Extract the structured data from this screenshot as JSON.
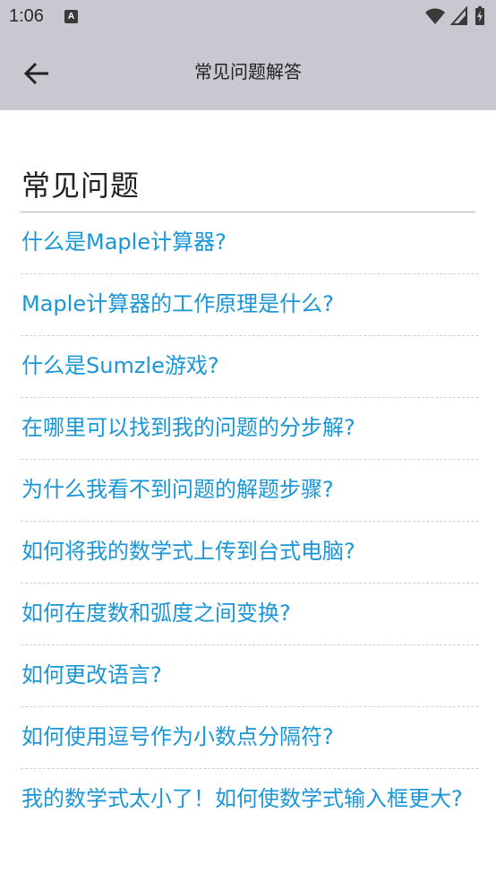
{
  "status_bar": {
    "time": "1:06",
    "notification_icon": "A"
  },
  "app_bar": {
    "title": "常见问题解答",
    "back_icon": "arrow-left-icon"
  },
  "section": {
    "title": "常见问题"
  },
  "faq": [
    "什么是Maple计算器?",
    "Maple计算器的工作原理是什么?",
    "什么是Sumzle游戏?",
    "在哪里可以找到我的问题的分步解?",
    "为什么我看不到问题的解题步骤?",
    "如何将我的数学式上传到台式电脑?",
    "如何在度数和弧度之间变换?",
    "如何更改语言?",
    "如何使用逗号作为小数点分隔符?",
    "我的数学式太小了！如何使数学式输入框更大?"
  ],
  "colors": {
    "link": "#1a96d6",
    "header_bg": "#c8c9d0"
  }
}
